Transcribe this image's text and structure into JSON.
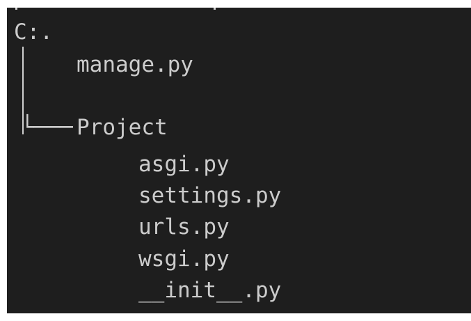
{
  "tree": {
    "root": "C:.",
    "root_file": "manage.py",
    "folder_connector": "└───",
    "folder": "Project",
    "folder_files": [
      "asgi.py",
      "settings.py",
      "urls.py",
      "wsgi.py",
      "__init__.py"
    ]
  },
  "colors": {
    "background": "#1e1e1e",
    "text": "#cccccc",
    "frame": "#ffffff"
  }
}
